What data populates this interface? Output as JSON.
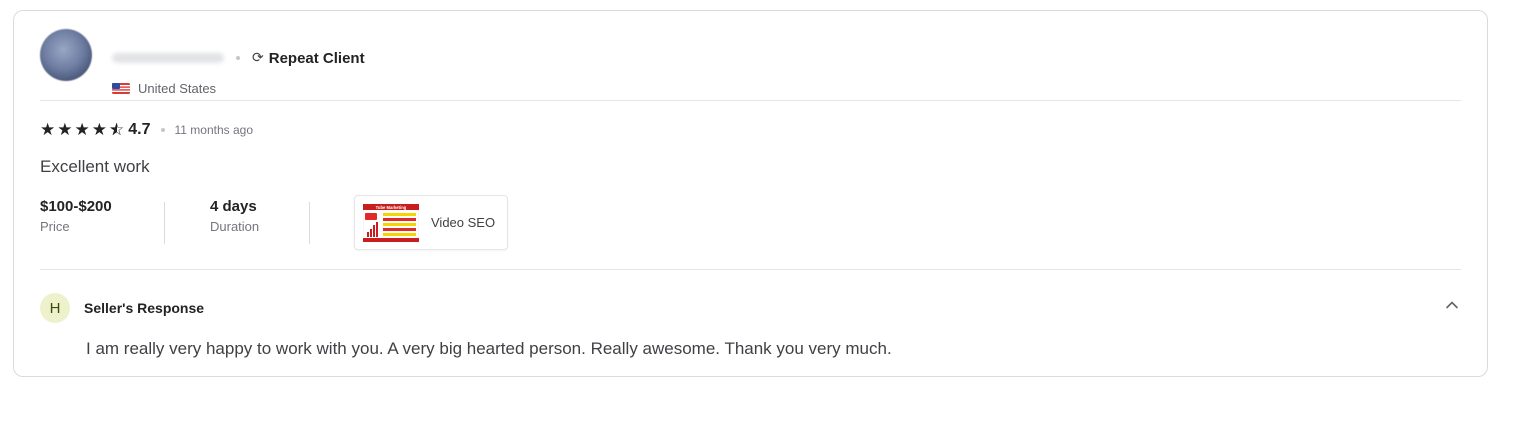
{
  "reviewer": {
    "badge": "Repeat Client",
    "badge_icon": "repeat-icon",
    "country": "United States",
    "flag": "us-flag"
  },
  "review": {
    "rating": "4.7",
    "stars_filled": 4,
    "stars_half": 1,
    "time_ago": "11 months ago",
    "text": "Excellent work"
  },
  "meta": {
    "price_value": "$100-$200",
    "price_label": "Price",
    "duration_value": "4 days",
    "duration_label": "Duration"
  },
  "gig": {
    "title": "Video SEO",
    "thumb_heading": "Tube Marketing"
  },
  "response": {
    "initial": "H",
    "title": "Seller's Response",
    "text": "I am really very happy to work with you. A very big hearted person. Really awesome. Thank you very much."
  },
  "colors": {
    "border": "#dadbdd",
    "text_dark": "#222325",
    "text_muted": "#74767e",
    "response_avatar_bg": "#eef2cc"
  }
}
